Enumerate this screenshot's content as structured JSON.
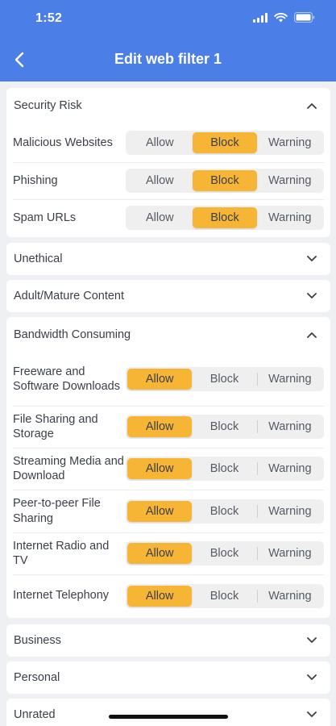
{
  "status": {
    "time": "1:52"
  },
  "nav": {
    "title": "Edit web filter 1"
  },
  "options": [
    "Allow",
    "Block",
    "Warning"
  ],
  "groups": [
    {
      "title": "Security Risk",
      "expanded": true,
      "items": [
        {
          "label": "Malicious Websites",
          "selected": "Block"
        },
        {
          "label": "Phishing",
          "selected": "Block"
        },
        {
          "label": "Spam URLs",
          "selected": "Block"
        }
      ]
    },
    {
      "title": "Unethical",
      "expanded": false,
      "items": []
    },
    {
      "title": "Adult/Mature Content",
      "expanded": false,
      "items": []
    },
    {
      "title": "Bandwidth Consuming",
      "expanded": true,
      "items": [
        {
          "label": "Freeware and Software Downloads",
          "selected": "Allow"
        },
        {
          "label": "File Sharing and Storage",
          "selected": "Allow"
        },
        {
          "label": "Streaming Media and Download",
          "selected": "Allow"
        },
        {
          "label": "Peer-to-peer File Sharing",
          "selected": "Allow"
        },
        {
          "label": "Internet Radio and TV",
          "selected": "Allow"
        },
        {
          "label": "Internet Telephony",
          "selected": "Allow"
        }
      ]
    },
    {
      "title": "Business",
      "expanded": false,
      "items": []
    },
    {
      "title": "Personal",
      "expanded": false,
      "items": []
    },
    {
      "title": "Unrated",
      "expanded": false,
      "items": []
    }
  ],
  "colors": {
    "header": "#4b7ee6",
    "selected": "#f7b536",
    "background": "#eef0f4"
  }
}
